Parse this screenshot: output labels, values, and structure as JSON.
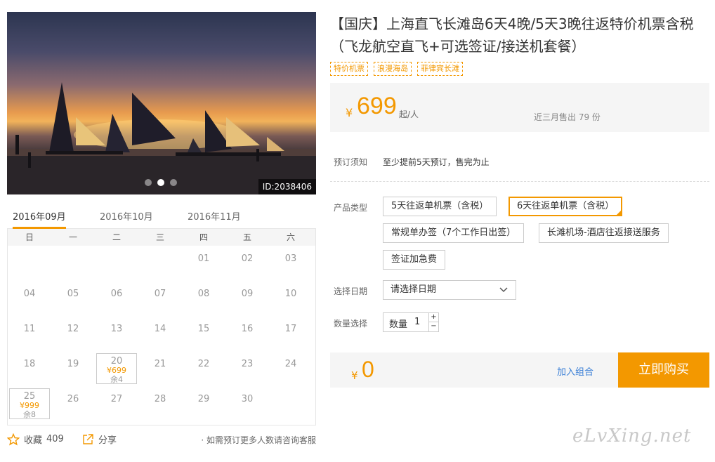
{
  "gallery": {
    "image_id": "ID:2038406",
    "dots": 3,
    "active_dot": 1
  },
  "calendar": {
    "months": [
      "2016年09月",
      "2016年10月",
      "2016年11月"
    ],
    "active_month": 0,
    "weekdays": [
      "日",
      "一",
      "二",
      "三",
      "四",
      "五",
      "六"
    ],
    "days": [
      {
        "d": "01",
        "col": 4,
        "row": 0
      },
      {
        "d": "02",
        "col": 5,
        "row": 0
      },
      {
        "d": "03",
        "col": 6,
        "row": 0
      },
      {
        "d": "04",
        "col": 0,
        "row": 1
      },
      {
        "d": "05",
        "col": 1,
        "row": 1
      },
      {
        "d": "06",
        "col": 2,
        "row": 1
      },
      {
        "d": "07",
        "col": 3,
        "row": 1
      },
      {
        "d": "08",
        "col": 4,
        "row": 1
      },
      {
        "d": "09",
        "col": 5,
        "row": 1
      },
      {
        "d": "10",
        "col": 6,
        "row": 1
      },
      {
        "d": "11",
        "col": 0,
        "row": 2
      },
      {
        "d": "12",
        "col": 1,
        "row": 2
      },
      {
        "d": "13",
        "col": 2,
        "row": 2
      },
      {
        "d": "14",
        "col": 3,
        "row": 2
      },
      {
        "d": "15",
        "col": 4,
        "row": 2
      },
      {
        "d": "16",
        "col": 5,
        "row": 2
      },
      {
        "d": "17",
        "col": 6,
        "row": 2
      },
      {
        "d": "18",
        "col": 0,
        "row": 3
      },
      {
        "d": "19",
        "col": 1,
        "row": 3
      },
      {
        "d": "20",
        "col": 2,
        "row": 3,
        "price": "¥699",
        "remain": "余4"
      },
      {
        "d": "21",
        "col": 3,
        "row": 3
      },
      {
        "d": "22",
        "col": 4,
        "row": 3
      },
      {
        "d": "23",
        "col": 5,
        "row": 3
      },
      {
        "d": "24",
        "col": 6,
        "row": 3
      },
      {
        "d": "25",
        "col": 0,
        "row": 4,
        "price": "¥999",
        "remain": "余8"
      },
      {
        "d": "26",
        "col": 1,
        "row": 4
      },
      {
        "d": "27",
        "col": 2,
        "row": 4
      },
      {
        "d": "28",
        "col": 3,
        "row": 4
      },
      {
        "d": "29",
        "col": 4,
        "row": 4
      },
      {
        "d": "30",
        "col": 5,
        "row": 4
      }
    ]
  },
  "actions": {
    "favorite_label": "收藏",
    "favorite_count": "409",
    "share_label": "分享",
    "note": "· 如需预订更多人数请咨询客服"
  },
  "product": {
    "title": "【国庆】上海直飞长滩岛6天4晚/5天3晚往返特价机票含税（飞龙航空直飞+可选签证/接送机套餐）",
    "tags": [
      "特价机票",
      "浪漫海岛",
      "菲律宾长滩"
    ],
    "currency": "¥",
    "price": "699",
    "price_unit": "起/人",
    "sold": "近三月售出 79 份"
  },
  "booking": {
    "notice_label": "预订须知",
    "notice_text": "至少提前5天预订，售完为止",
    "type_label": "产品类型",
    "options": [
      "5天往返单机票（含税）",
      "6天往返单机票（含税）",
      "常规单办签（7个工作日出签）",
      "长滩机场-酒店往返接送服务",
      "签证加急费"
    ],
    "selected_option": 1,
    "date_label": "选择日期",
    "date_placeholder": "请选择日期",
    "qty_label": "数量选择",
    "qty_inner_label": "数量",
    "qty_value": "1",
    "total_currency": "¥",
    "total": "0",
    "combo_label": "加入组合",
    "buy_label": "立即购买"
  },
  "colors": {
    "accent": "#f39800",
    "link": "#3a7fd6"
  },
  "watermark": "eLvXing.net"
}
